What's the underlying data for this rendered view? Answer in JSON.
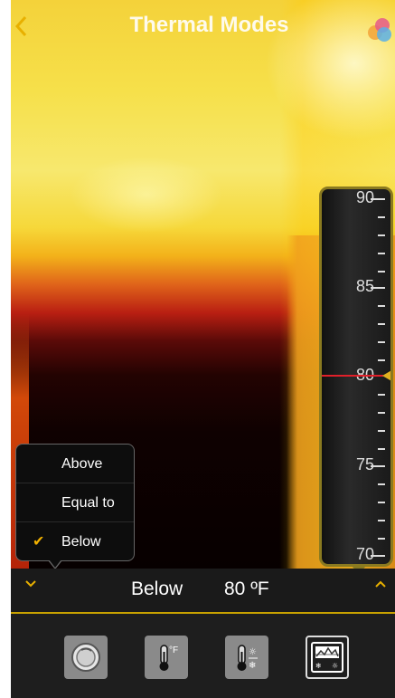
{
  "header": {
    "title": "Thermal Modes",
    "back_icon": "chevron-left-icon",
    "palette_icon": "color-palette-icon"
  },
  "scale": {
    "labels": [
      "90",
      "85",
      "80",
      "75",
      "70"
    ],
    "threshold": 80,
    "marker_color": "#e0202a",
    "pointer_color": "#e0b020"
  },
  "popup": {
    "options": [
      {
        "label": "Above",
        "selected": false
      },
      {
        "label": "Equal to",
        "selected": false
      },
      {
        "label": "Below",
        "selected": true
      }
    ],
    "check_icon": "checkmark-icon"
  },
  "bottom_bar": {
    "mode": "Below",
    "value": "80 ºF",
    "expand_icon": "chevron-down-icon",
    "collapse_icon": "chevron-up-icon"
  },
  "toolbar": {
    "tools": [
      {
        "icon": "spot-meter-icon",
        "active": false
      },
      {
        "icon": "thermometer-fahrenheit-icon",
        "active": false,
        "label": "°F"
      },
      {
        "icon": "thermometer-hot-cold-icon",
        "active": false
      },
      {
        "icon": "thermal-alarm-icon",
        "active": true
      }
    ]
  },
  "colors": {
    "accent": "#f0b000",
    "bar": "#1a1a1a"
  }
}
